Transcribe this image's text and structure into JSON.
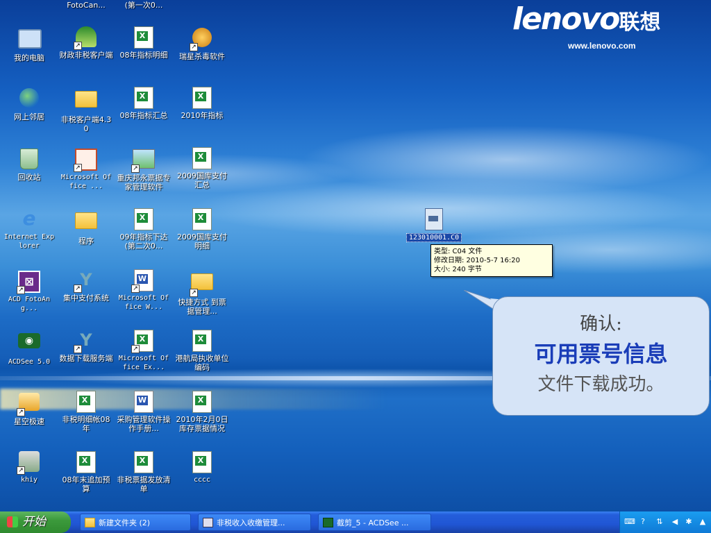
{
  "desktop": {
    "brand": {
      "logo": "lenovo",
      "logo_cn": "联想",
      "url": "www.lenovo.com"
    },
    "top_partial": [
      "FotoCan...",
      "(第一次0..."
    ],
    "icons": [
      {
        "label": "我的电脑",
        "icon": "my-computer-icon"
      },
      {
        "label": "财政非税客户端",
        "icon": "antenna-icon"
      },
      {
        "label": "08年指标明细",
        "icon": "excel-file-icon"
      },
      {
        "label": "瑞星杀毒软件",
        "icon": "rising-antivirus-icon"
      },
      {
        "label": "网上邻居",
        "icon": "network-places-icon"
      },
      {
        "label": "非税客户端4.30",
        "icon": "folder-icon"
      },
      {
        "label": "08年指标汇总",
        "icon": "excel-file-icon"
      },
      {
        "label": "2010年指标",
        "icon": "excel-file-icon"
      },
      {
        "label": "回收站",
        "icon": "recycle-bin-icon"
      },
      {
        "label": "Microsoft Office ...",
        "icon": "powerpoint-icon"
      },
      {
        "label": "重庆邦永票据专家管理软件",
        "icon": "picture-icon"
      },
      {
        "label": "2009国库支付汇总",
        "icon": "excel-file-icon"
      },
      {
        "label": "Internet Explorer",
        "icon": "internet-explorer-icon"
      },
      {
        "label": "程序",
        "icon": "folder-icon"
      },
      {
        "label": "09年指标下达(第二次0...",
        "icon": "excel-file-icon"
      },
      {
        "label": "2009国库支付明细",
        "icon": "excel-file-icon"
      },
      {
        "label": "ACD FotoAng...",
        "icon": "acd-icon"
      },
      {
        "label": "集中支付系统",
        "icon": "payment-system-icon"
      },
      {
        "label": "Microsoft Office W...",
        "icon": "word-icon"
      },
      {
        "label": "快捷方式 到票据管理...",
        "icon": "folder-shortcut-icon"
      },
      {
        "label": "ACDSee 5.0",
        "icon": "acdsee-eye-icon"
      },
      {
        "label": "数据下载服务端",
        "icon": "download-service-icon"
      },
      {
        "label": "Microsoft Office Ex...",
        "icon": "excel-app-icon"
      },
      {
        "label": "港航局执收单位编码",
        "icon": "excel-file-icon"
      },
      {
        "label": "星空极速",
        "icon": "star-icon"
      },
      {
        "label": "非税明细帐08年",
        "icon": "excel-file-icon"
      },
      {
        "label": "采购管理软件操作手册...",
        "icon": "word-doc-icon"
      },
      {
        "label": "2010年2月0日库存票据情况",
        "icon": "excel-file-icon"
      },
      {
        "label": "khiy",
        "icon": "network-computer-icon"
      },
      {
        "label": "08年末追加预算",
        "icon": "excel-file-icon"
      },
      {
        "label": "非税票据发放清单",
        "icon": "excel-file-icon"
      },
      {
        "label": "cccc",
        "icon": "excel-file-icon"
      }
    ],
    "selected_file": {
      "label": "123010001.C0",
      "icon": "c04-file-icon"
    },
    "tooltip": {
      "type": "类型: C04 文件",
      "modified": "修改日期: 2010-5-7 16:20",
      "size": "大小: 240 字节"
    },
    "callout": {
      "line1": "确认:",
      "line2": "可用票号信息",
      "line3": "文件下载成功。"
    }
  },
  "taskbar": {
    "start_label": "开始",
    "tasks": [
      {
        "label": "新建文件夹 (2)",
        "icon": "folder-icon"
      },
      {
        "label": "非税收入收缴管理...",
        "icon": "app-icon"
      },
      {
        "label": "截剪_5 - ACDSee ...",
        "icon": "acdsee-icon"
      }
    ],
    "tray": [
      "keyboard-icon",
      "help-icon",
      "network-icon",
      "back-icon",
      "security-icon"
    ]
  }
}
